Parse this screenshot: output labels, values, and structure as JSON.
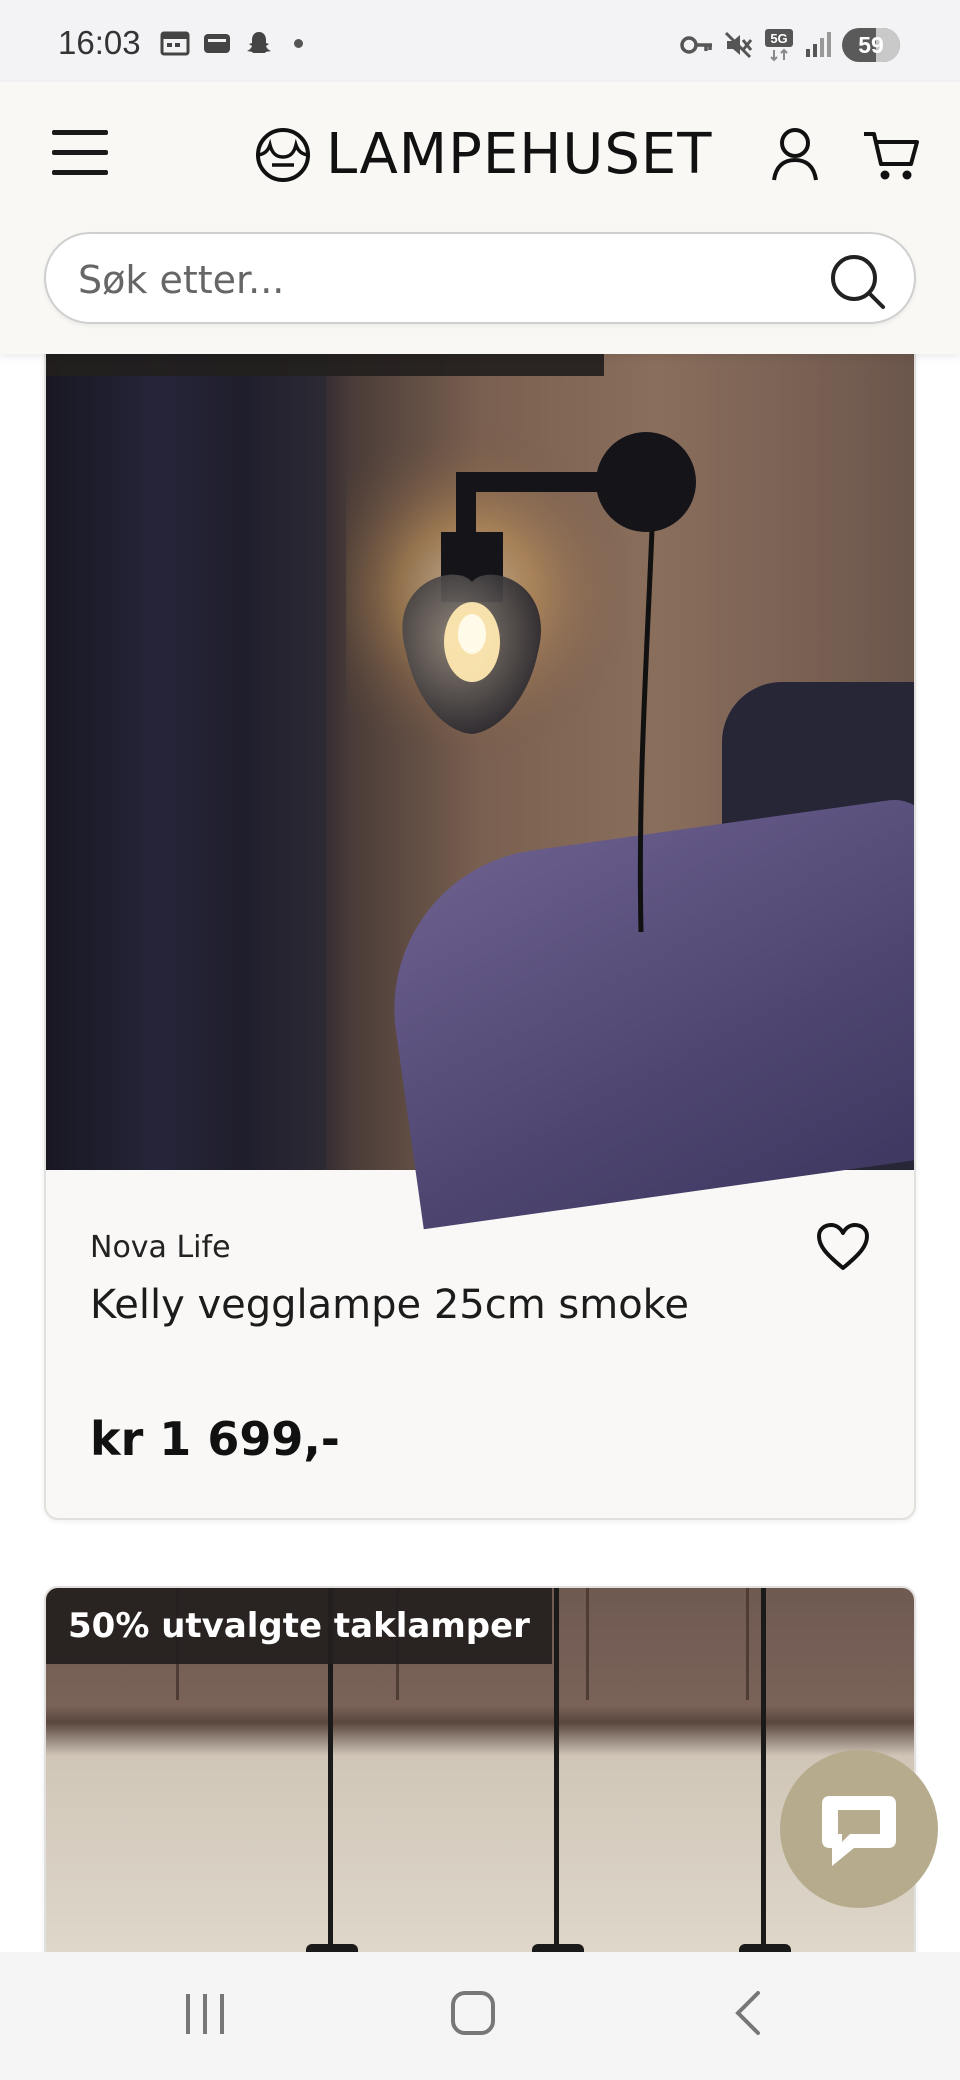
{
  "status_bar": {
    "time": "16:03",
    "left_icons": [
      "calendar-icon",
      "wallet-icon",
      "snapchat-icon",
      "dot-icon"
    ],
    "right_icons": [
      "vpn-key-icon",
      "mute-icon",
      "5g-icon",
      "signal-icon"
    ],
    "network": "5G",
    "battery_percent": 59,
    "battery_label": "59"
  },
  "header": {
    "logo_text": "LAMPEHUSET",
    "search": {
      "placeholder": "Søk etter..."
    }
  },
  "products": [
    {
      "label": "",
      "brand": "Nova Life",
      "title": "Kelly vegglampe 25cm smoke",
      "price": "kr 1 699,-",
      "favorite": false
    },
    {
      "label": "50% utvalgte taklamper"
    }
  ],
  "colors": {
    "header_bg": "#f9f8f4",
    "card_bg": "#f9f8f6",
    "label_bg": "#231f1e",
    "chat_fab": "#b7ab8e"
  },
  "nav": [
    "recent-apps-icon",
    "home-icon",
    "back-icon"
  ]
}
